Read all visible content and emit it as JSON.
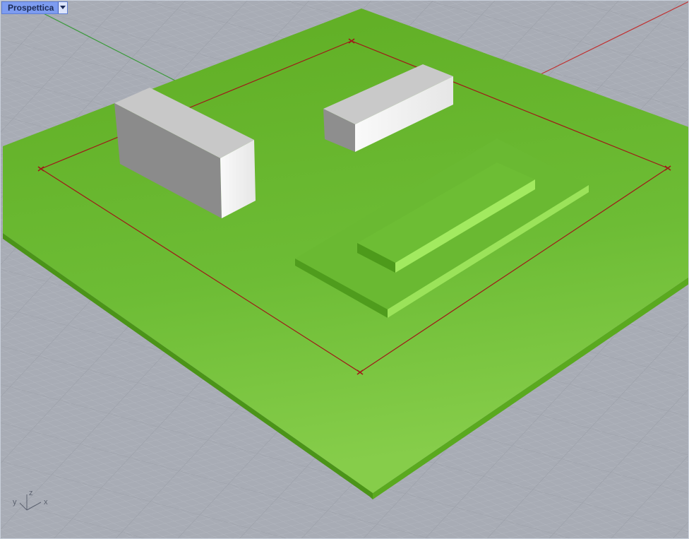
{
  "viewport": {
    "name": "Prospettica",
    "menu_icon": "dropdown-triangle-icon"
  },
  "axes": {
    "x": "x",
    "y": "y",
    "z": "z"
  },
  "colors": {
    "background": "#a8acb5",
    "grid_minor": "#b4b8c0",
    "grid_major": "#9da1aa",
    "terrain_top": "#6fbf3a",
    "buildings": "#ffffff",
    "boundary": "#a01818",
    "x_axis": "#c03030",
    "y_axis": "#3a9a3a"
  }
}
